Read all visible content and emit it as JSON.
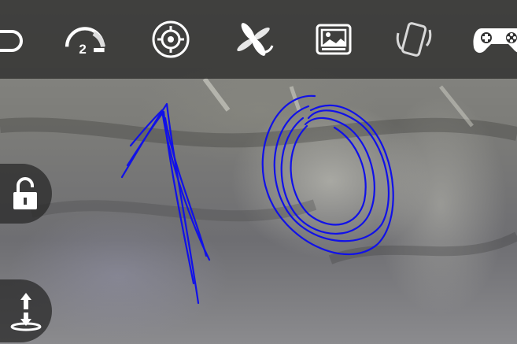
{
  "toolbar": {
    "items": [
      {
        "id": "return",
        "icon": "return-arrow-icon"
      },
      {
        "id": "speed",
        "icon": "speed-gauge-icon",
        "value": "2"
      },
      {
        "id": "calibrate",
        "icon": "crosshair-icon"
      },
      {
        "id": "flip",
        "icon": "drone-propeller-icon"
      },
      {
        "id": "gallery",
        "icon": "image-gallery-icon"
      },
      {
        "id": "gravity",
        "icon": "phone-tilt-icon"
      },
      {
        "id": "controller",
        "icon": "gamepad-icon"
      }
    ]
  },
  "side_controls": {
    "lock": {
      "icon": "unlock-icon"
    },
    "altitude": {
      "icon": "altitude-hold-icon"
    }
  },
  "annotation": {
    "text": "10",
    "color": "#1111e8"
  },
  "colors": {
    "toolbar_bg": "#30302e",
    "icon": "#ffffff"
  }
}
